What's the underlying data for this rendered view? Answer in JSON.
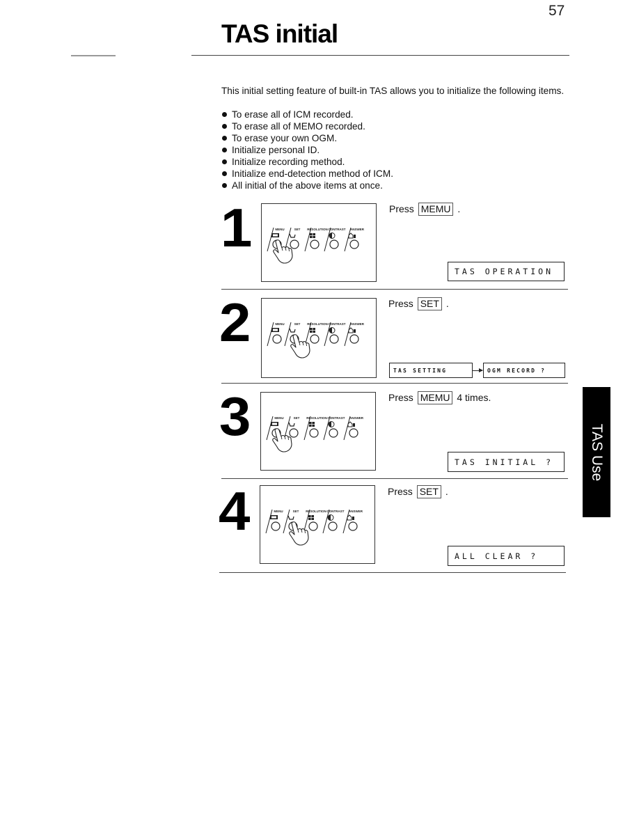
{
  "page": {
    "number": "57",
    "title": "TAS initial",
    "side_tab": "TAS Use"
  },
  "intro": {
    "paragraph": "This initial setting feature of built-in TAS allows you to initialize the following items.",
    "bullets": [
      "To erase all of ICM recorded.",
      "To erase all of MEMO recorded.",
      "To erase your own OGM.",
      "Initialize personal ID.",
      "Initialize recording method.",
      "Initialize end-detection method of ICM.",
      "All initial of the above items at once."
    ]
  },
  "panel_labels": [
    "MENU",
    "SET",
    "RESOLUTION",
    "CONTRAST",
    "ANSWER"
  ],
  "panel_icons": [
    "menu-icon",
    "set-icon",
    "resolution-icon",
    "contrast-icon",
    "answer-icon"
  ],
  "steps": [
    {
      "number": "1",
      "press_prefix": "Press",
      "key": "MEMU",
      "press_suffix": ".",
      "pressed_button": "MENU",
      "display": [
        "TAS OPERATION"
      ]
    },
    {
      "number": "2",
      "press_prefix": "Press",
      "key": "SET",
      "press_suffix": ".",
      "pressed_button": "SET",
      "display": [
        "TAS SETTING",
        "OGM RECORD ?"
      ]
    },
    {
      "number": "3",
      "press_prefix": "Press",
      "key": "MEMU",
      "press_suffix": "4 times.",
      "pressed_button": "MENU",
      "display": [
        "TAS INITIAL ?"
      ]
    },
    {
      "number": "4",
      "press_prefix": "Press",
      "key": "SET",
      "press_suffix": ".",
      "pressed_button": "SET",
      "display": [
        "ALL CLEAR ?"
      ]
    }
  ]
}
